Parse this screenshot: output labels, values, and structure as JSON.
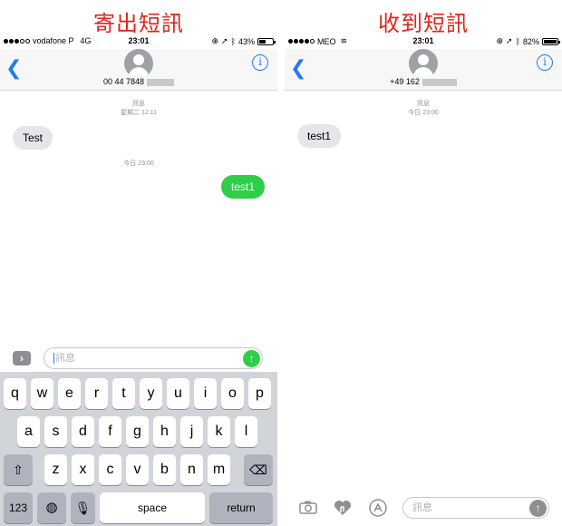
{
  "captions": {
    "left": "寄出短訊",
    "right": "收到短訊"
  },
  "left_phone": {
    "status": {
      "carrier": "vodafone P",
      "network": "4G",
      "time": "23:01",
      "battery": "43%",
      "battery_level": 0.43
    },
    "nav": {
      "back_icon": "chevron-left-icon",
      "info_icon": "info-icon",
      "contact_number": "00 44 7848"
    },
    "thread": {
      "timestamp1_label": "訊息",
      "timestamp1_time": "星期二 12:11",
      "msg1": "Test",
      "timestamp2": "今日 23:00",
      "msg2": "test1"
    },
    "input": {
      "expand_icon": "chevron-right-icon",
      "placeholder": "訊息",
      "send_icon": "arrow-up-icon",
      "send_color": "#2fce48"
    },
    "keyboard": {
      "row1": [
        "q",
        "w",
        "e",
        "r",
        "t",
        "y",
        "u",
        "i",
        "o",
        "p"
      ],
      "row2": [
        "a",
        "s",
        "d",
        "f",
        "g",
        "h",
        "j",
        "k",
        "l"
      ],
      "row3": [
        "z",
        "x",
        "c",
        "v",
        "b",
        "n",
        "m"
      ],
      "shift_icon": "shift-icon",
      "delete_icon": "delete-icon",
      "numbers_label": "123",
      "globe_icon": "globe-icon",
      "mic_icon": "microphone-icon",
      "space_label": "space",
      "return_label": "return"
    }
  },
  "right_phone": {
    "status": {
      "carrier": "MEO",
      "time": "23:01",
      "battery": "82%",
      "battery_level": 0.82
    },
    "nav": {
      "back_icon": "chevron-left-icon",
      "info_icon": "info-icon",
      "contact_number": "+49 162"
    },
    "thread": {
      "timestamp1_label": "訊息",
      "timestamp1_time": "今日 23:00",
      "msg1": "test1"
    },
    "input": {
      "camera_icon": "camera-icon",
      "digital_touch_icon": "digital-touch-icon",
      "app_store_icon": "app-store-icon",
      "placeholder": "訊息",
      "send_icon": "arrow-up-icon",
      "send_color": "#8e8e93"
    }
  }
}
